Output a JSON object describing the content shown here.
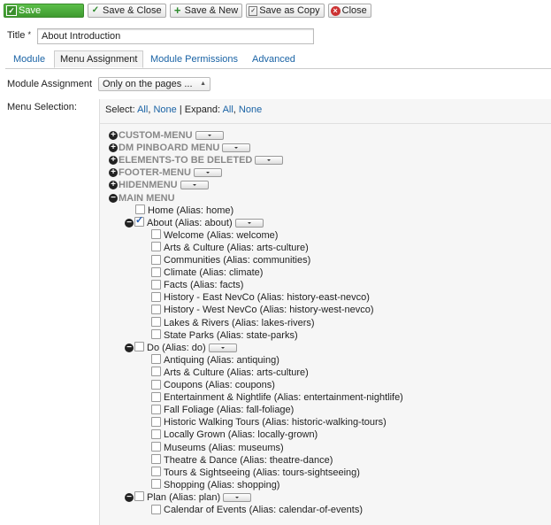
{
  "toolbar": {
    "save": "Save",
    "save_close": "Save & Close",
    "save_new": "Save & New",
    "save_copy": "Save as Copy",
    "close": "Close"
  },
  "title": {
    "label": "Title",
    "required_mark": "*",
    "value": "About Introduction"
  },
  "tabs": [
    {
      "label": "Module"
    },
    {
      "label": "Menu Assignment"
    },
    {
      "label": "Module Permissions"
    },
    {
      "label": "Advanced"
    }
  ],
  "module_assignment": {
    "label": "Module Assignment",
    "selected": "Only on the pages ..."
  },
  "menu_selection": {
    "label": "Menu Selection:",
    "select_prefix": "Select:",
    "all": "All",
    "none": "None",
    "separator": "|",
    "expand_prefix": "Expand:",
    "expand_all": "All",
    "expand_none": "None"
  },
  "menus": [
    {
      "name": "CUSTOM-MENU",
      "expanded": false
    },
    {
      "name": "DM PINBOARD MENU",
      "expanded": false
    },
    {
      "name": "ELEMENTS-TO BE DELETED",
      "expanded": false
    },
    {
      "name": "FOOTER-MENU",
      "expanded": false
    },
    {
      "name": "HIDENMENU",
      "expanded": false
    },
    {
      "name": "MAIN MENU",
      "expanded": true
    }
  ],
  "main_menu_items": {
    "home": "Home (Alias: home)",
    "about": "About (Alias: about)",
    "about_children": [
      "Welcome (Alias: welcome)",
      "Arts & Culture (Alias: arts-culture)",
      "Communities (Alias: communities)",
      "Climate (Alias: climate)",
      "Facts (Alias: facts)",
      "History - East NevCo (Alias: history-east-nevco)",
      "History - West NevCo (Alias: history-west-nevco)",
      "Lakes & Rivers (Alias: lakes-rivers)",
      "State Parks (Alias: state-parks)"
    ],
    "do": "Do (Alias: do)",
    "do_children": [
      "Antiquing (Alias: antiquing)",
      "Arts & Culture (Alias: arts-culture)",
      "Coupons (Alias: coupons)",
      "Entertainment & Nightlife (Alias: entertainment-nightlife)",
      "Fall Foliage (Alias: fall-foliage)",
      "Historic Walking Tours (Alias: historic-walking-tours)",
      "Locally Grown (Alias: locally-grown)",
      "Museums (Alias: museums)",
      "Theatre & Dance (Alias: theatre-dance)",
      "Tours & Sightseeing (Alias: tours-sightseeing)",
      "Shopping (Alias: shopping)"
    ],
    "plan": "Plan (Alias: plan)",
    "plan_children": [
      "Calendar of Events (Alias: calendar-of-events)"
    ]
  },
  "icons": {
    "save": "check-icon",
    "save_new": "plus-icon",
    "save_copy": "copy-icon",
    "close": "close-icon",
    "expand": "plus-circle-icon",
    "collapse": "minus-circle-icon"
  },
  "colors": {
    "save_green": "#4caf3a",
    "link_blue": "#1a63a5",
    "menu_grey": "#888888",
    "panel_bg": "#f6f6f6"
  }
}
